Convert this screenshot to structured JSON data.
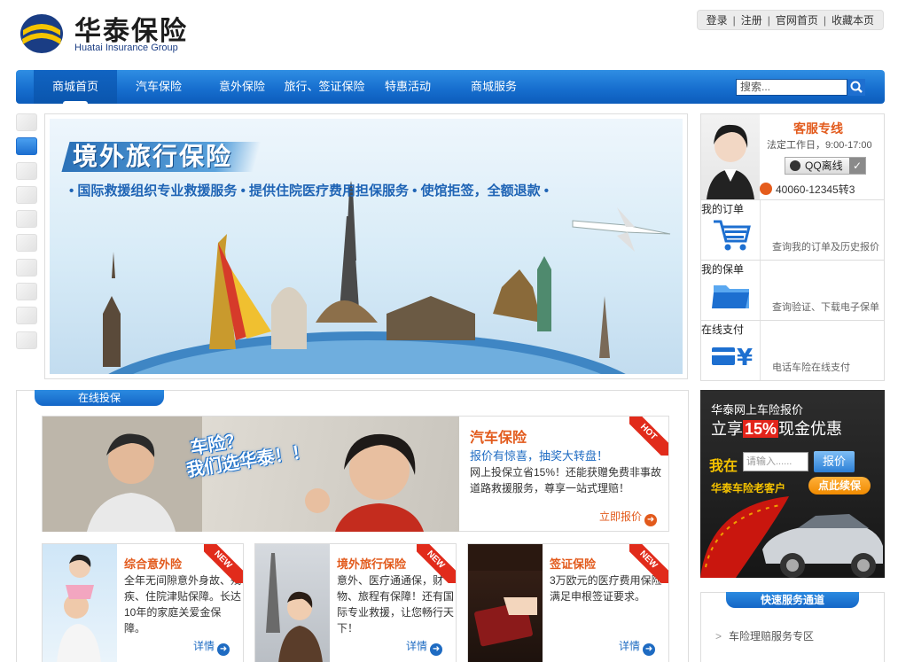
{
  "header": {
    "logo_cn": "华泰保险",
    "logo_en": "Huatai Insurance Group",
    "top_links": [
      "登录",
      "注册",
      "官网首页",
      "收藏本页"
    ]
  },
  "nav": {
    "items": [
      "商城首页",
      "汽车保险",
      "意外保险",
      "旅行、签证保险",
      "特惠活动",
      "商城服务"
    ],
    "active_index": 0,
    "search_placeholder": "搜索..."
  },
  "banner": {
    "title": "境外旅行保险",
    "subtitle": "• 国际救援组织专业救援服务 • 提供住院医疗费用担保服务 • 使馆拒签，全额退款 •",
    "slide_count": 10,
    "active_slide": 1
  },
  "service": {
    "title": "客服专线",
    "hours": "法定工作日，9:00-17:00",
    "qq_label": "QQ离线",
    "phone": "40060-12345转3"
  },
  "side_links": [
    {
      "label": "我的订单",
      "desc": "查询我的订单及历史报价",
      "icon": "cart-icon"
    },
    {
      "label": "我的保单",
      "desc": "查询验证、下载电子保单",
      "icon": "folder-icon"
    },
    {
      "label": "在线支付",
      "desc": "电话车险在线支付",
      "icon": "payment-icon"
    }
  ],
  "online": {
    "tab": "在线投保",
    "car": {
      "slogan_line1": "车险？",
      "slogan_line2": "我们选华泰！！",
      "title": "汽车保险",
      "subtitle": "报价有惊喜，抽奖大转盘！",
      "desc": "网上投保立省15%！还能获赠免费非事故道路救援服务，尊享一站式理赔！",
      "link": "立即报价",
      "badge": "HOT"
    },
    "cards": [
      {
        "title": "综合意外险",
        "desc": "全年无间隙意外身故、残疾、住院津贴保障。长达10年的家庭关爱金保障。",
        "link": "详情",
        "badge": "NEW"
      },
      {
        "title": "境外旅行保险",
        "desc": "意外、医疗通通保，财物、旅程有保障！还有国际专业救援，让您畅行天下！",
        "link": "详情",
        "badge": "NEW"
      },
      {
        "title": "签证保险",
        "desc": "3万欧元的医疗费用保险满足申根签证要求。",
        "link": "详情",
        "badge": "NEW"
      }
    ]
  },
  "quote": {
    "line1": "华泰网上车险报价",
    "line2_pre": "立享",
    "line2_highlight": "15%",
    "line2_post": "现金优惠",
    "prompt": "我在",
    "input_placeholder": "请输入......",
    "button": "报价",
    "old_customer": "华泰车险老客户",
    "renew": "点此续保"
  },
  "fast": {
    "tab": "快速服务通道",
    "item": "车险理赔服务专区"
  }
}
